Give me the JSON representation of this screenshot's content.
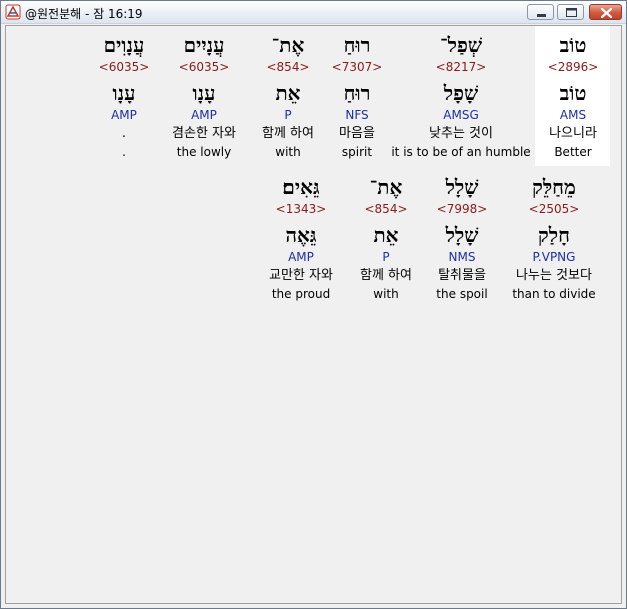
{
  "window": {
    "title": "@원전분해 - 잠 16:19",
    "buttons": {
      "minimize": "minimize",
      "maximize": "maximize",
      "close": "close"
    }
  },
  "colors": {
    "strong_number": "#8b1a1a",
    "morphology": "#1c2fa8",
    "highlight_background": "#ffffff"
  },
  "verse": {
    "line1": [
      {
        "hebrew": "טוֹב",
        "strongs": "<2896>",
        "lemma": "טוֹב",
        "morph": "AMS",
        "korean": "나으니라",
        "english": "Better"
      },
      {
        "hebrew": "שְׁפַל־",
        "strongs": "<8217>",
        "lemma": "שָׁפָל",
        "morph": "AMSG",
        "korean": "낮추는 것이",
        "english": "it is to be of an humble"
      },
      {
        "hebrew": "רוּחַ",
        "strongs": "<7307>",
        "lemma": "רוּחַ",
        "morph": "NFS",
        "korean": "마음을",
        "english": "spirit"
      },
      {
        "hebrew": "אֶת־",
        "strongs": "<854>",
        "lemma": "אֵת",
        "morph": "P",
        "korean": "함께 하여",
        "english": "with"
      },
      {
        "hebrew": "עֲנָיִים",
        "strongs": "<6035>",
        "lemma": "עָנָו",
        "morph": "AMP",
        "korean": "겸손한 자와",
        "english": "the lowly"
      },
      {
        "hebrew": "עֲנָוִים",
        "strongs": "<6035>",
        "lemma": "עָנָו",
        "morph": "AMP",
        "korean": ".",
        "english": "."
      }
    ],
    "line2": [
      {
        "hebrew": "מֵחַלֵּק",
        "strongs": "<2505>",
        "lemma": "חָלַק",
        "morph": "P.VPNG",
        "korean": "나누는 것보다",
        "english": "than to divide"
      },
      {
        "hebrew": "שָׁלָל",
        "strongs": "<7998>",
        "lemma": "שָׁלָל",
        "morph": "NMS",
        "korean": "탈취물을",
        "english": "the spoil"
      },
      {
        "hebrew": "אֶת־",
        "strongs": "<854>",
        "lemma": "אֵת",
        "morph": "P",
        "korean": "함께 하여",
        "english": "with"
      },
      {
        "hebrew": "גֵּאִים׃",
        "strongs": "<1343>",
        "lemma": "גֵּאֶה",
        "morph": "AMP",
        "korean": "교만한 자와",
        "english": "the proud"
      }
    ]
  }
}
